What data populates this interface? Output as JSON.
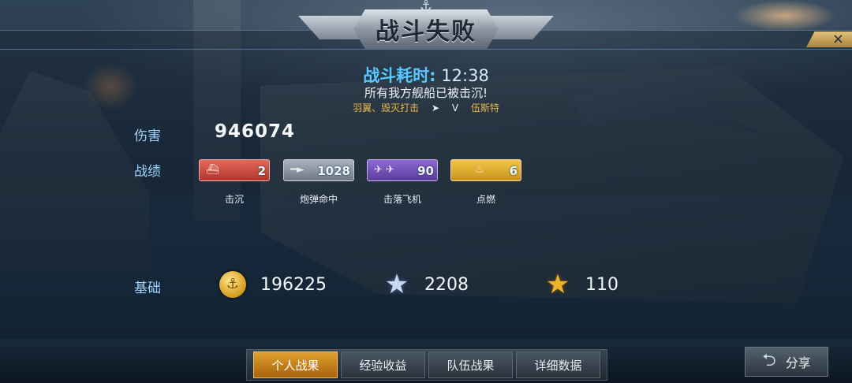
{
  "title": "战斗失败",
  "close_icon": "×",
  "battle_time": {
    "label": "战斗耗时:",
    "value": "12:38"
  },
  "message": "所有我方舰船已被击沉!",
  "sub": {
    "left": "羽翼、毁灭打击",
    "mid": "V",
    "right": "伍斯特"
  },
  "damage": {
    "label": "伤害",
    "value": "946074"
  },
  "record": {
    "label": "战绩",
    "items": [
      {
        "name": "击沉",
        "value": "2",
        "color": "#c9463a",
        "icon": "ship-icon"
      },
      {
        "name": "炮弹命中",
        "value": "1028",
        "color": "#8a95a2",
        "icon": "shell-icon"
      },
      {
        "name": "击落飞机",
        "value": "90",
        "color": "#7250b8",
        "icon": "plane-icon"
      },
      {
        "name": "点燃",
        "value": "6",
        "color": "#dfa82c",
        "icon": "fire-icon"
      }
    ]
  },
  "basic": {
    "label": "基础",
    "coins": "196225",
    "exp": "2208",
    "stars": "110"
  },
  "tabs": [
    {
      "label": "个人战果",
      "active": true
    },
    {
      "label": "经验收益",
      "active": false
    },
    {
      "label": "队伍战果",
      "active": false
    },
    {
      "label": "详细数据",
      "active": false
    }
  ],
  "share": {
    "label": "分享",
    "icon": "share-arrow-icon"
  }
}
